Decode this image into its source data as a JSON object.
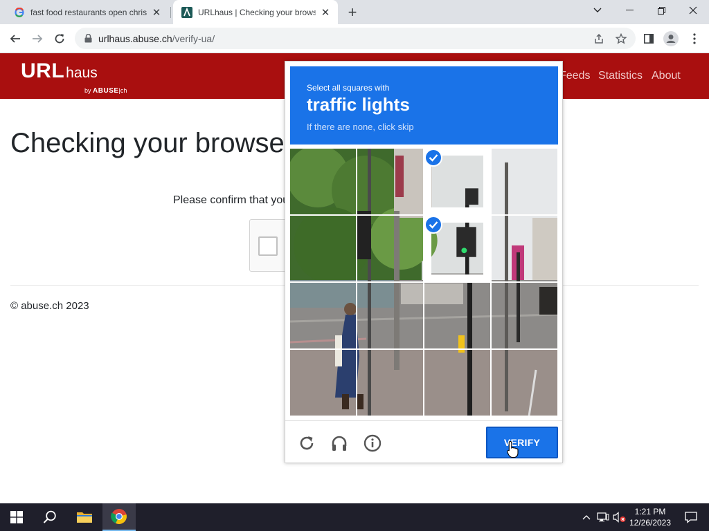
{
  "browser": {
    "tabs": [
      {
        "title": "fast food restaurants open christ",
        "icon": "google-icon"
      },
      {
        "title": "URLhaus | Checking your browse",
        "icon": "abuse-icon"
      }
    ],
    "url_host": "urlhaus.abuse.ch",
    "url_path": "/verify-ua/"
  },
  "site": {
    "brand": "URL",
    "brand_sub": "haus",
    "by_prefix": "by",
    "by_brand": "ABUSE",
    "by_suffix": "|ch",
    "nav": [
      "Feeds",
      "Statistics",
      "About"
    ],
    "page_title": "Checking your browse",
    "confirm_text": "Please confirm that you",
    "footer": "© abuse.ch 2023",
    "colors": {
      "header": "#a90f0f"
    }
  },
  "captcha": {
    "instruction": "Select all squares with",
    "target": "traffic lights",
    "hint": "If there are none, click skip",
    "verify_label": "VERIFY",
    "selected_tiles": [
      2,
      6
    ],
    "colors": {
      "accent": "#1a73e8"
    }
  },
  "taskbar": {
    "time": "1:21 PM",
    "date": "12/26/2023"
  }
}
